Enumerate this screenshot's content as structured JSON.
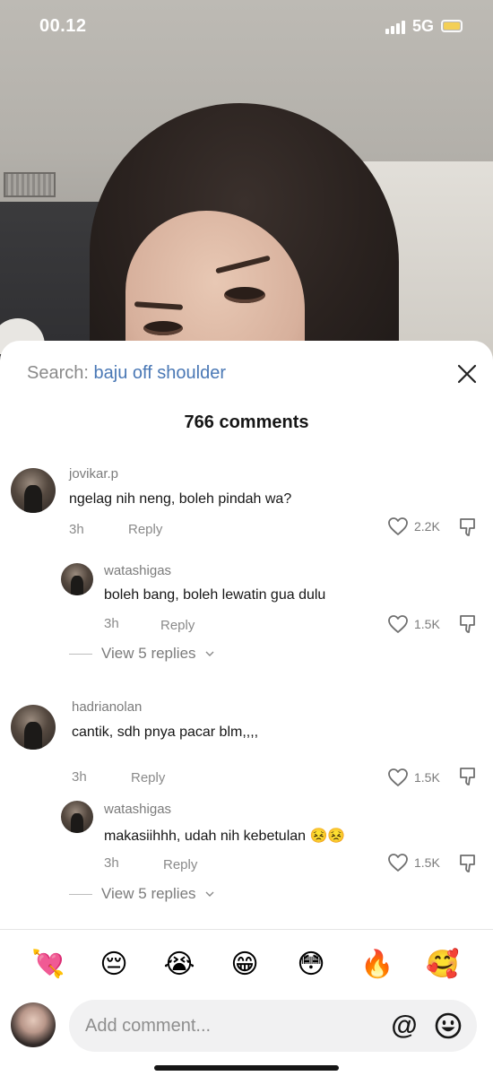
{
  "status_bar": {
    "time": "00.12",
    "network": "5G"
  },
  "search": {
    "prefix": "Search:",
    "term": "baju off shoulder"
  },
  "comment_count": "766 comments",
  "comments": [
    {
      "username": "jovikar.p",
      "text": "ngelag nih neng, boleh pindah wa?",
      "time": "3h",
      "reply_label": "Reply",
      "likes": "2.2K"
    },
    {
      "username": "watashigas",
      "text": "boleh bang, boleh lewatin gua dulu",
      "time": "3h",
      "reply_label": "Reply",
      "likes": "1.5K"
    },
    {
      "username": "hadrianolan",
      "text": "cantik, sdh pnya pacar blm,,,,",
      "time": "3h",
      "reply_label": "Reply",
      "likes": "1.5K"
    },
    {
      "username": "watashigas",
      "text": "makasiihhh, udah nih kebetulan 😣😣",
      "time": "3h",
      "reply_label": "Reply",
      "likes": "1.5K"
    }
  ],
  "view_replies": [
    "View 5 replies",
    "View 5 replies"
  ],
  "emoji_bar": [
    "💘",
    "😔",
    "😭",
    "😁",
    "😳",
    "🔥",
    "🥰"
  ],
  "compose": {
    "placeholder": "Add comment...",
    "mention": "@"
  },
  "colors": {
    "accent": "#4a78b5",
    "text": "#161616",
    "muted": "#8a8a8a",
    "battery": "#f3cf56"
  }
}
